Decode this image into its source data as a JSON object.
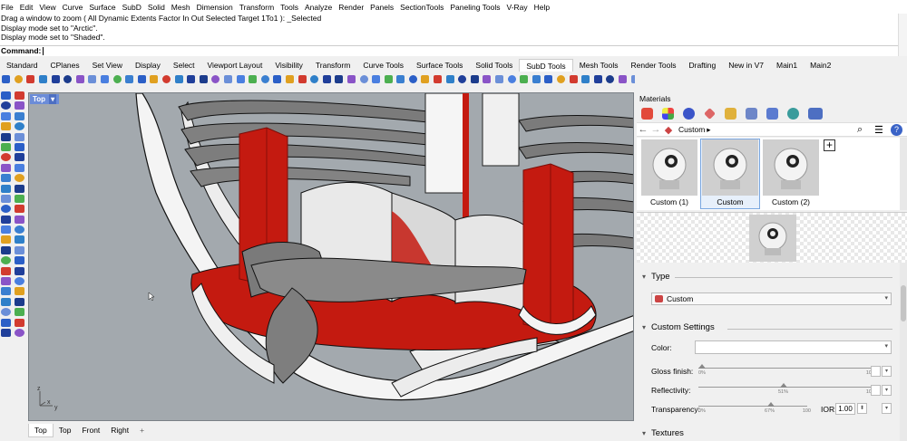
{
  "menu": [
    "File",
    "Edit",
    "View",
    "Curve",
    "Surface",
    "SubD",
    "Solid",
    "Mesh",
    "Dimension",
    "Transform",
    "Tools",
    "Analyze",
    "Render",
    "Panels",
    "SectionTools",
    "Paneling Tools",
    "V-Ray",
    "Help"
  ],
  "command_history": [
    "Drag a window to zoom ( All  Dynamic  Extents  Factor  In  Out  Selected  Target  1To1 ): _Selected",
    "Display mode set to \"Arctic\".",
    "Display mode set to \"Shaded\"."
  ],
  "command_prompt": "Command:",
  "toolbar_tabs": [
    "Standard",
    "CPlanes",
    "Set View",
    "Display",
    "Select",
    "Viewport Layout",
    "Visibility",
    "Transform",
    "Curve Tools",
    "Surface Tools",
    "Solid Tools",
    "SubD Tools",
    "Mesh Tools",
    "Render Tools",
    "Drafting",
    "New in V7",
    "Main1",
    "Main2"
  ],
  "active_toolbar_tab": "SubD Tools",
  "viewport": {
    "title": "Top",
    "axis_x": "x",
    "axis_y": "y",
    "axis_z": "z"
  },
  "viewport_tabs": [
    "Top",
    "Top",
    "Front",
    "Right"
  ],
  "viewport_tab_add": "+",
  "materials_panel": {
    "title": "Materials",
    "breadcrumb": "Custom",
    "materials": [
      {
        "label": "Custom (1)",
        "selected": false
      },
      {
        "label": "Custom",
        "selected": true
      },
      {
        "label": "Custom (2)",
        "selected": false
      }
    ],
    "add_button": "+",
    "type_section": "Type",
    "type_value": "Custom",
    "custom_settings_section": "Custom Settings",
    "color_label": "Color:",
    "gloss_label": "Gloss finish:",
    "gloss_lo": "0%",
    "gloss_hi": "100",
    "reflectivity_label": "Reflectivity:",
    "reflectivity_mid": "51%",
    "reflectivity_hi": "100",
    "transparency_label": "Transparency:",
    "transparency_lo": "0%",
    "transparency_mid": "67%",
    "transparency_hi": "100",
    "ior_label": "IOR:",
    "ior_value": "1.00",
    "textures_section": "Textures"
  },
  "colors": {
    "accent_red": "#c41a10",
    "viewport_bg": "#a3a9ae",
    "viewport_label": "#6b8cd8",
    "selection": "#7aa7e0"
  }
}
